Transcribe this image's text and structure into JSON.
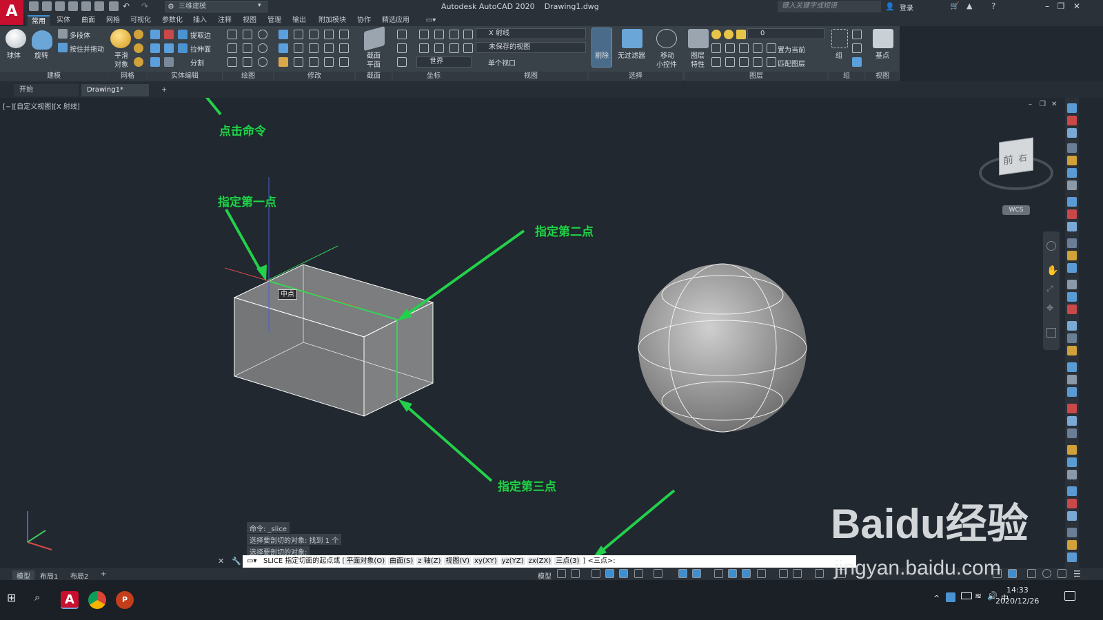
{
  "window": {
    "app_title": "Autodesk AutoCAD 2020",
    "file_name": "Drawing1.dwg",
    "workspace": "三维建模",
    "search_placeholder": "键入关键字或短语",
    "login": "登录"
  },
  "ribbon_tabs": [
    "常用",
    "实体",
    "曲面",
    "网格",
    "可视化",
    "参数化",
    "插入",
    "注释",
    "视图",
    "管理",
    "输出",
    "附加模块",
    "协作",
    "精选应用"
  ],
  "ribbon": {
    "modeling": {
      "sphere": "球体",
      "revolve": "旋转",
      "polysolid": "多段体",
      "presspull": "按住并拖动",
      "label": "建模"
    },
    "mesh": {
      "smooth": "平滑",
      "object": "对象",
      "label": "网格"
    },
    "solid_edit": {
      "extract_edges": "提取边",
      "extrude_faces": "拉伸面",
      "separate": "分割",
      "label": "实体编辑"
    },
    "draw": {
      "label": "绘图"
    },
    "modify": {
      "label": "修改"
    },
    "section": {
      "section_plane": "截面",
      "plane": "平面",
      "label": "截面"
    },
    "coordinates": {
      "world": "世界",
      "label": "坐标"
    },
    "view": {
      "visual_style": "X 射线",
      "unsaved_view": "未保存的视图",
      "single_viewport": "单个视口",
      "label": "视图"
    },
    "selection": {
      "culling": "剔除",
      "no_filter": "无过滤器",
      "move_gizmo": "移动",
      "move_gizmo2": "小控件",
      "label": "选择"
    },
    "layers": {
      "layer_props": "图层",
      "layer_props2": "特性",
      "current_layer": "0",
      "set_current": "置为当前",
      "match_layer": "匹配图层",
      "label": "图层"
    },
    "groups": {
      "group": "组",
      "label": "组"
    },
    "view2": {
      "base": "基点",
      "label": "视图"
    }
  },
  "doc_tabs": {
    "start": "开始",
    "drawing": "Drawing1*",
    "add": "+"
  },
  "viewport": {
    "label": "[−][自定义视图][X 射线]",
    "viewcube_front": "前",
    "viewcube_right": "右",
    "wcs": "WCS",
    "midpoint_tooltip": "中点"
  },
  "annotations": {
    "click_command": "点击命令",
    "first_point": "指定第一点",
    "second_point": "指定第二点",
    "third_point": "指定第三点"
  },
  "command": {
    "history": [
      "命令: _slice",
      "选择要剖切的对象: 找到 1 个",
      "选择要剖切的对象:"
    ],
    "prompt": "SLICE 指定切面的起点或 [",
    "options": [
      "平面对象(O)",
      "曲面(S)",
      "z 轴(Z)",
      "视图(V)",
      "xy(XY)",
      "yz(YZ)",
      "zx(ZX)",
      "三点(3)"
    ],
    "suffix": "] <三点>:"
  },
  "layout_tabs": [
    "模型",
    "布局1",
    "布局2",
    "+"
  ],
  "status": {
    "model": "模型"
  },
  "taskbar": {
    "time": "14:33",
    "date": "2020/12/26",
    "ime": "中"
  },
  "watermark": {
    "logo": "Baidu经验",
    "url": "jingyan.baidu.com"
  },
  "colors": {
    "accent": "#3c8fd0",
    "annotation_green": "#22d04a",
    "viewport_bg": "#212830"
  }
}
